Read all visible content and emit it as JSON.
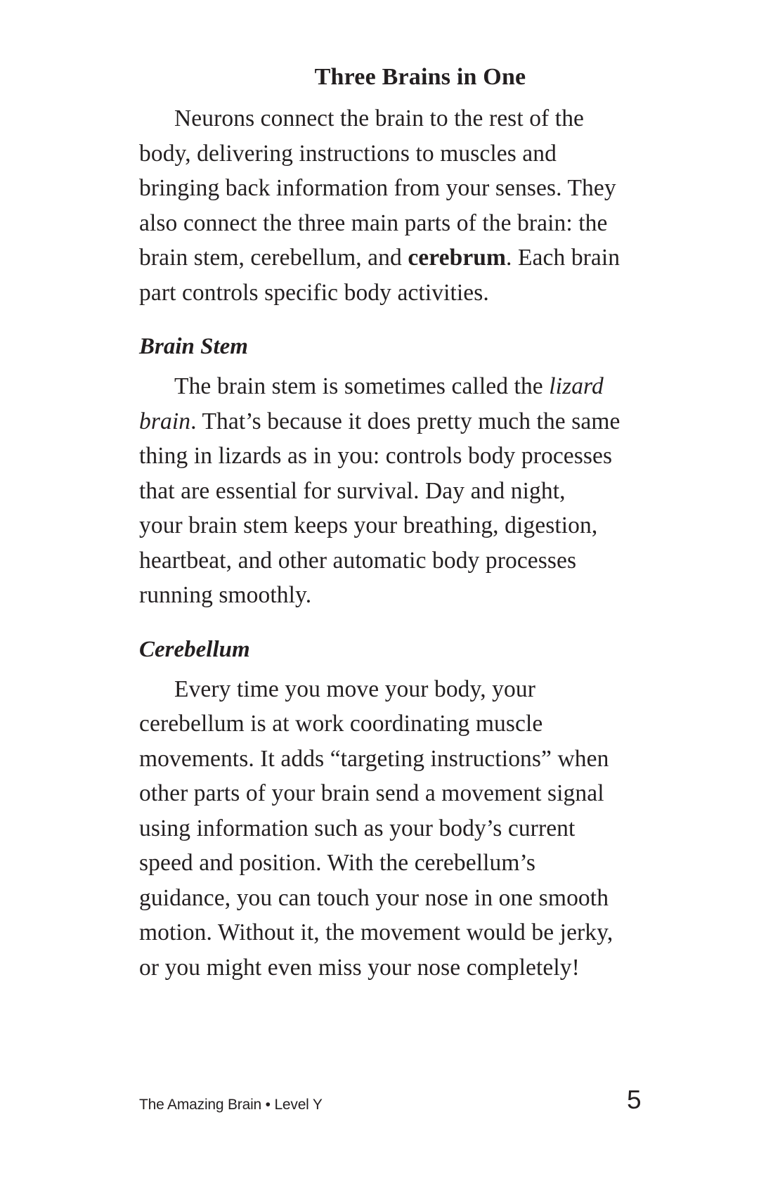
{
  "title": "Three Brains in One",
  "intro": {
    "lines": [
      "Neurons connect the brain to the rest of the",
      "body, delivering instructions to muscles and",
      "bringing back information from your senses. They",
      "also connect the three main parts of the brain: the"
    ],
    "line5_a": "brain stem, cerebellum, and ",
    "line5_bold": "cerebrum",
    "line5_b": ". Each brain",
    "line6": "part controls specific body activities."
  },
  "brain_stem": {
    "heading": "Brain Stem",
    "line1_a": "The brain stem is sometimes called the ",
    "line1_italic": "lizard",
    "line2_italic": "brain",
    "line2_b": ". That’s because it does pretty much the same",
    "lines": [
      "thing in lizards as in you: controls body processes",
      "that are essential for survival. Day and night,",
      "your brain stem keeps your breathing, digestion,",
      "heartbeat, and other automatic body processes",
      "running smoothly."
    ]
  },
  "cerebellum": {
    "heading": "Cerebellum",
    "lines": [
      "Every time you move your body, your",
      "cerebellum is at work coordinating muscle",
      "movements. It adds “targeting instructions” when",
      "other parts of your brain send a movement signal",
      "using information such as your body’s current",
      "speed and position. With the cerebellum’s",
      "guidance, you can touch your nose in one smooth",
      "motion. Without it, the movement would be jerky,",
      "or you might even miss your nose completely!"
    ]
  },
  "footer": {
    "book_title": "The Amazing Brain • Level Y",
    "page_number": "5"
  }
}
